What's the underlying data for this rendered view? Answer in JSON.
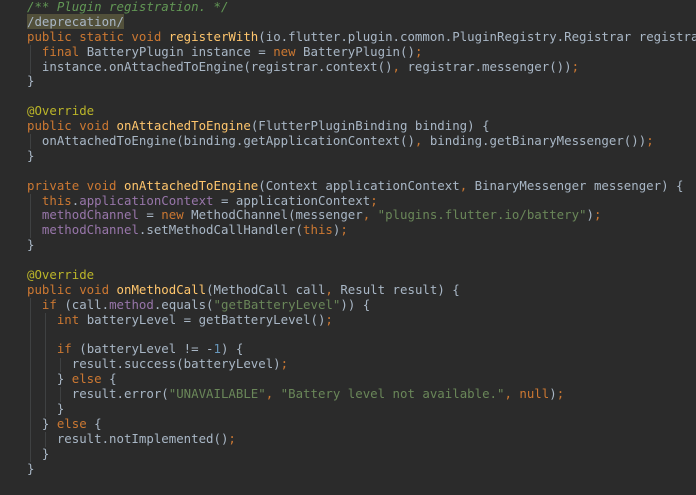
{
  "editor": {
    "colors": {
      "background": "#2b2b2b",
      "plain": "#a9b7c6",
      "keyword": "#cc7832",
      "comment": "#629755",
      "string": "#6a8759",
      "number": "#6897bb",
      "annotation": "#bbb529",
      "method": "#ffc66d",
      "field": "#9876aa"
    },
    "lines": [
      [
        {
          "t": "comment",
          "v": "/** Plugin registration. */"
        }
      ],
      [
        {
          "t": "depr",
          "v": "/deprecation/"
        }
      ],
      [
        {
          "t": "keyword",
          "v": "public static void "
        },
        {
          "t": "method",
          "v": "registerWith"
        },
        {
          "t": "plain",
          "v": "(io.flutter.plugin.common.PluginRegistry.Registrar registrar) {"
        }
      ],
      [
        {
          "t": "plain",
          "v": "  "
        },
        {
          "t": "keyword",
          "v": "final "
        },
        {
          "t": "plain",
          "v": "BatteryPlugin instance = "
        },
        {
          "t": "keyword",
          "v": "new "
        },
        {
          "t": "plain",
          "v": "BatteryPlugin()"
        },
        {
          "t": "keyword",
          "v": ";"
        }
      ],
      [
        {
          "t": "plain",
          "v": "  instance.onAttachedToEngine(registrar.context()"
        },
        {
          "t": "keyword",
          "v": ", "
        },
        {
          "t": "plain",
          "v": "registrar.messenger())"
        },
        {
          "t": "keyword",
          "v": ";"
        }
      ],
      [
        {
          "t": "plain",
          "v": "}"
        }
      ],
      [
        {
          "t": "plain",
          "v": ""
        }
      ],
      [
        {
          "t": "annotation",
          "v": "@Override"
        }
      ],
      [
        {
          "t": "keyword",
          "v": "public void "
        },
        {
          "t": "method",
          "v": "onAttachedToEngine"
        },
        {
          "t": "plain",
          "v": "(FlutterPluginBinding binding) {"
        }
      ],
      [
        {
          "t": "plain",
          "v": "  onAttachedToEngine(binding.getApplicationContext()"
        },
        {
          "t": "keyword",
          "v": ", "
        },
        {
          "t": "plain",
          "v": "binding.getBinaryMessenger())"
        },
        {
          "t": "keyword",
          "v": ";"
        }
      ],
      [
        {
          "t": "plain",
          "v": "}"
        }
      ],
      [
        {
          "t": "plain",
          "v": ""
        }
      ],
      [
        {
          "t": "keyword",
          "v": "private void "
        },
        {
          "t": "method",
          "v": "onAttachedToEngine"
        },
        {
          "t": "plain",
          "v": "(Context applicationContext"
        },
        {
          "t": "keyword",
          "v": ", "
        },
        {
          "t": "plain",
          "v": "BinaryMessenger messenger) {"
        }
      ],
      [
        {
          "t": "plain",
          "v": "  "
        },
        {
          "t": "keyword",
          "v": "this"
        },
        {
          "t": "plain",
          "v": "."
        },
        {
          "t": "field",
          "v": "applicationContext "
        },
        {
          "t": "plain",
          "v": "= applicationContext"
        },
        {
          "t": "keyword",
          "v": ";"
        }
      ],
      [
        {
          "t": "plain",
          "v": "  "
        },
        {
          "t": "field",
          "v": "methodChannel "
        },
        {
          "t": "plain",
          "v": "= "
        },
        {
          "t": "keyword",
          "v": "new "
        },
        {
          "t": "plain",
          "v": "MethodChannel(messenger"
        },
        {
          "t": "keyword",
          "v": ", "
        },
        {
          "t": "string",
          "v": "\"plugins.flutter.io/battery\""
        },
        {
          "t": "plain",
          "v": ")"
        },
        {
          "t": "keyword",
          "v": ";"
        }
      ],
      [
        {
          "t": "plain",
          "v": "  "
        },
        {
          "t": "field",
          "v": "methodChannel"
        },
        {
          "t": "plain",
          "v": ".setMethodCallHandler("
        },
        {
          "t": "keyword",
          "v": "this"
        },
        {
          "t": "plain",
          "v": ")"
        },
        {
          "t": "keyword",
          "v": ";"
        }
      ],
      [
        {
          "t": "plain",
          "v": "}"
        }
      ],
      [
        {
          "t": "plain",
          "v": ""
        }
      ],
      [
        {
          "t": "annotation",
          "v": "@Override"
        }
      ],
      [
        {
          "t": "keyword",
          "v": "public void "
        },
        {
          "t": "method",
          "v": "onMethodCall"
        },
        {
          "t": "plain",
          "v": "(MethodCall call"
        },
        {
          "t": "keyword",
          "v": ", "
        },
        {
          "t": "plain",
          "v": "Result result) {"
        }
      ],
      [
        {
          "t": "plain",
          "v": "  "
        },
        {
          "t": "keyword",
          "v": "if "
        },
        {
          "t": "plain",
          "v": "(call."
        },
        {
          "t": "field",
          "v": "method"
        },
        {
          "t": "plain",
          "v": ".equals("
        },
        {
          "t": "string",
          "v": "\"getBatteryLevel\""
        },
        {
          "t": "plain",
          "v": ")) {"
        }
      ],
      [
        {
          "t": "plain",
          "v": "    "
        },
        {
          "t": "keyword",
          "v": "int "
        },
        {
          "t": "plain",
          "v": "batteryLevel = getBatteryLevel()"
        },
        {
          "t": "keyword",
          "v": ";"
        }
      ],
      [
        {
          "t": "plain",
          "v": ""
        }
      ],
      [
        {
          "t": "plain",
          "v": "    "
        },
        {
          "t": "keyword",
          "v": "if "
        },
        {
          "t": "plain",
          "v": "(batteryLevel != -"
        },
        {
          "t": "number",
          "v": "1"
        },
        {
          "t": "plain",
          "v": ") {"
        }
      ],
      [
        {
          "t": "plain",
          "v": "      result.success(batteryLevel)"
        },
        {
          "t": "keyword",
          "v": ";"
        }
      ],
      [
        {
          "t": "plain",
          "v": "    } "
        },
        {
          "t": "keyword",
          "v": "else "
        },
        {
          "t": "plain",
          "v": "{"
        }
      ],
      [
        {
          "t": "plain",
          "v": "      result.error("
        },
        {
          "t": "string",
          "v": "\"UNAVAILABLE\""
        },
        {
          "t": "keyword",
          "v": ", "
        },
        {
          "t": "string",
          "v": "\"Battery level not available.\""
        },
        {
          "t": "keyword",
          "v": ", null"
        },
        {
          "t": "plain",
          "v": ")"
        },
        {
          "t": "keyword",
          "v": ";"
        }
      ],
      [
        {
          "t": "plain",
          "v": "    }"
        }
      ],
      [
        {
          "t": "plain",
          "v": "  } "
        },
        {
          "t": "keyword",
          "v": "else "
        },
        {
          "t": "plain",
          "v": "{"
        }
      ],
      [
        {
          "t": "plain",
          "v": "    result.notImplemented()"
        },
        {
          "t": "keyword",
          "v": ";"
        }
      ],
      [
        {
          "t": "plain",
          "v": "  }"
        }
      ],
      [
        {
          "t": "plain",
          "v": "}"
        }
      ]
    ]
  }
}
